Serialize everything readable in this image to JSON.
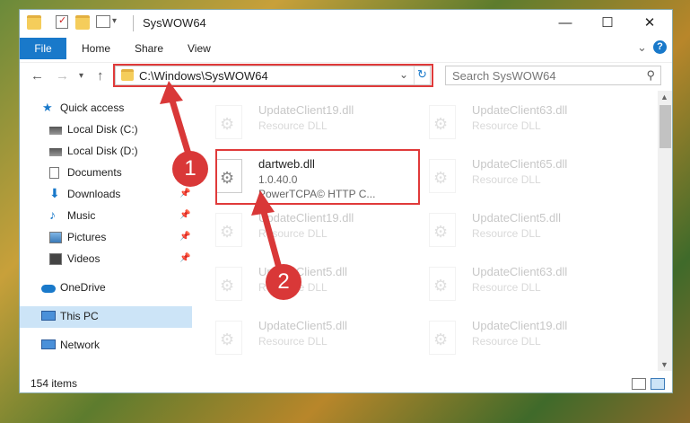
{
  "window": {
    "title": "SysWOW64",
    "minimize": "—",
    "maximize": "☐",
    "close": "✕",
    "qa_dropdown": "▾"
  },
  "ribbon": {
    "file": "File",
    "home": "Home",
    "share": "Share",
    "view": "View",
    "collapse": "⌄",
    "help": "?"
  },
  "nav": {
    "back": "←",
    "forward": "→",
    "recent": "▾",
    "up": "↑",
    "address": "C:\\Windows\\SysWOW64",
    "address_dropdown": "⌄",
    "refresh": "↻",
    "search_placeholder": "Search SysWOW64",
    "search_icon": "⚲"
  },
  "sidebar": {
    "items": [
      {
        "label": "Quick access"
      },
      {
        "label": "Local Disk (C:)"
      },
      {
        "label": "Local Disk (D:)"
      },
      {
        "label": "Documents"
      },
      {
        "label": "Downloads"
      },
      {
        "label": "Music"
      },
      {
        "label": "Pictures"
      },
      {
        "label": "Videos"
      },
      {
        "label": "OneDrive"
      },
      {
        "label": "This PC"
      },
      {
        "label": "Network"
      }
    ],
    "pin": "📌"
  },
  "files": {
    "highlighted": {
      "name": "dartweb.dll",
      "version": "1.0.40.0",
      "company": "PowerTCPA© HTTP C..."
    },
    "left_col": [
      {
        "name": "UpdateClient19.dll",
        "desc": "Resource DLL"
      },
      {
        "name": "UpdateClient19.dll",
        "desc": "Resource DLL"
      },
      {
        "name": "UpdateClient5.dll",
        "desc": "Resource DLL"
      },
      {
        "name": "UpdateClient5.dll",
        "desc": "Resource DLL"
      }
    ],
    "right_col": [
      {
        "name": "UpdateClient63.dll",
        "desc": "Resource DLL"
      },
      {
        "name": "UpdateClient65.dll",
        "desc": "Resource DLL"
      },
      {
        "name": "UpdateClient5.dll",
        "desc": "Resource DLL"
      },
      {
        "name": "UpdateClient63.dll",
        "desc": "Resource DLL"
      },
      {
        "name": "UpdateClient19.dll",
        "desc": "Resource DLL"
      }
    ],
    "gear": "⚙"
  },
  "status": {
    "count": "154 items"
  },
  "annotations": {
    "step1": "1",
    "step2": "2",
    "color": "#d93838"
  }
}
